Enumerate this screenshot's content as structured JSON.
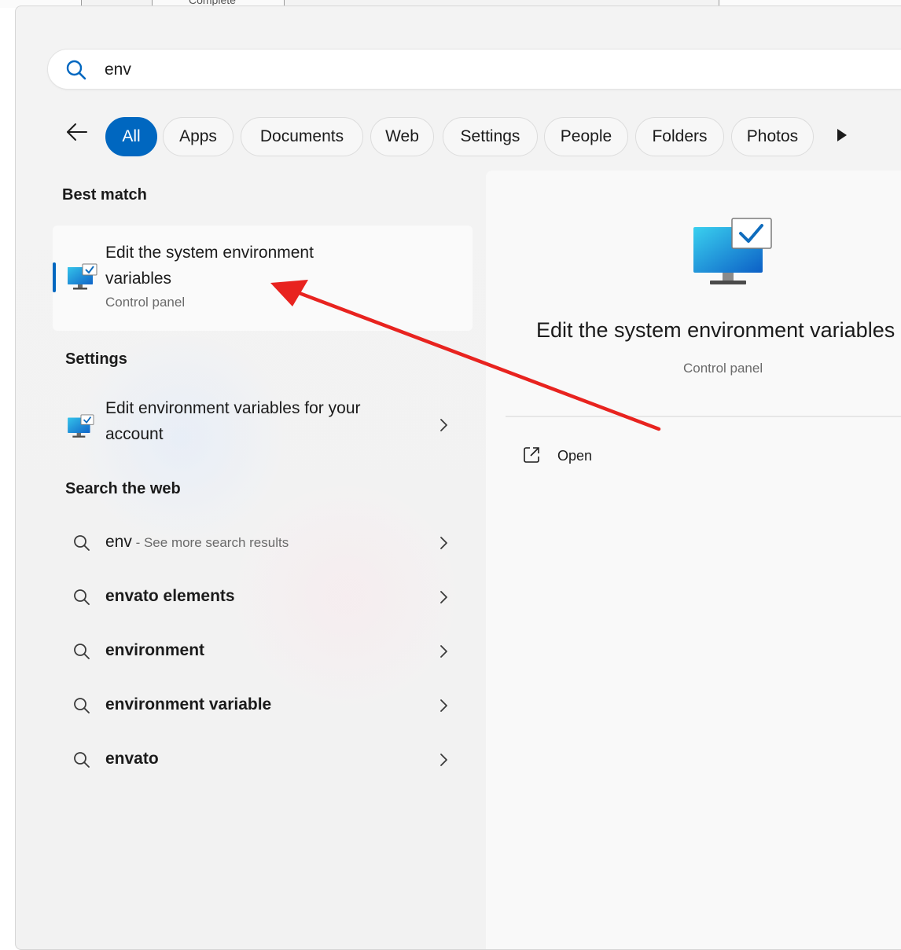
{
  "background": {
    "tab_text": "Complete"
  },
  "search": {
    "value": "env",
    "icon": "search-icon"
  },
  "filters": {
    "back_icon": "arrow-left-icon",
    "items": [
      "All",
      "Apps",
      "Documents",
      "Web",
      "Settings",
      "People",
      "Folders",
      "Photos"
    ],
    "active": "All",
    "more_icon": "play-arrow-icon"
  },
  "best_match": {
    "heading": "Best match",
    "title": "Edit the system environment variables",
    "subtitle": "Control panel",
    "icon": "monitor-check-icon"
  },
  "settings": {
    "heading": "Settings",
    "item": "Edit environment variables for your account"
  },
  "web": {
    "heading": "Search the web",
    "first": {
      "query": "env",
      "suffix": " - See more search results"
    },
    "suggestions": [
      "envato elements",
      "environment",
      "environment variable",
      "envato"
    ]
  },
  "preview": {
    "title": "Edit the system environment variables",
    "subtitle": "Control panel",
    "action": "Open",
    "action_icon": "open-external-icon"
  },
  "colors": {
    "accent": "#0067c0",
    "annotation_arrow": "#e8231f"
  }
}
